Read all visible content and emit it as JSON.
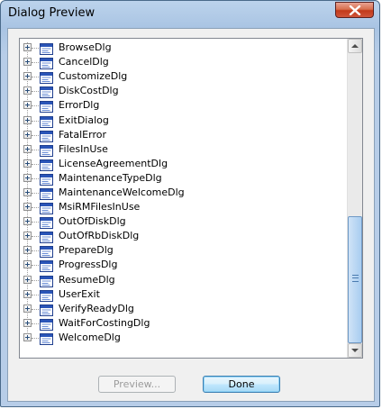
{
  "window": {
    "title": "Dialog Preview"
  },
  "tree": {
    "items": [
      {
        "label": "BrowseDlg"
      },
      {
        "label": "CancelDlg"
      },
      {
        "label": "CustomizeDlg"
      },
      {
        "label": "DiskCostDlg"
      },
      {
        "label": "ErrorDlg"
      },
      {
        "label": "ExitDialog"
      },
      {
        "label": "FatalError"
      },
      {
        "label": "FilesInUse"
      },
      {
        "label": "LicenseAgreementDlg"
      },
      {
        "label": "MaintenanceTypeDlg"
      },
      {
        "label": "MaintenanceWelcomeDlg"
      },
      {
        "label": "MsiRMFilesInUse"
      },
      {
        "label": "OutOfDiskDlg"
      },
      {
        "label": "OutOfRbDiskDlg"
      },
      {
        "label": "PrepareDlg"
      },
      {
        "label": "ProgressDlg"
      },
      {
        "label": "ResumeDlg"
      },
      {
        "label": "UserExit"
      },
      {
        "label": "VerifyReadyDlg"
      },
      {
        "label": "WaitForCostingDlg"
      },
      {
        "label": "WelcomeDlg"
      }
    ],
    "item_icon": "dialog-window-icon",
    "expander_icon": "plus-expander-icon",
    "scroll_position": 0.55
  },
  "buttons": {
    "preview_label": "Preview...",
    "done_label": "Done"
  },
  "colors": {
    "frame": "#b7cde8",
    "close_button": "#c2391a",
    "done_button": "#bee6fd",
    "scroll_thumb": "#a9cdf0"
  }
}
